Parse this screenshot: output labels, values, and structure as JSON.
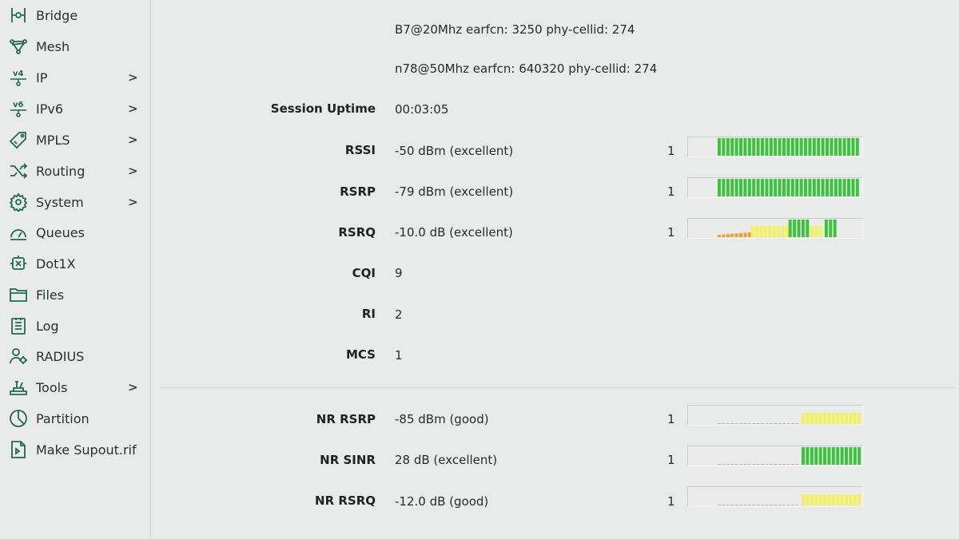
{
  "colors": {
    "accent_green": "#1f6b4f",
    "bar_green": "#3cc23c",
    "bar_yellow": "#f2f25a",
    "bar_orange": "#f0a030",
    "bar_gray": "#b9b9b9"
  },
  "sidebar": {
    "items": [
      {
        "label": "Bridge",
        "icon": "bridge-icon",
        "has_submenu": false
      },
      {
        "label": "Mesh",
        "icon": "mesh-icon",
        "has_submenu": false
      },
      {
        "label": "IP",
        "icon": "ipv4-icon",
        "has_submenu": true
      },
      {
        "label": "IPv6",
        "icon": "ipv6-icon",
        "has_submenu": true
      },
      {
        "label": "MPLS",
        "icon": "tag-icon",
        "has_submenu": true
      },
      {
        "label": "Routing",
        "icon": "routing-icon",
        "has_submenu": true
      },
      {
        "label": "System",
        "icon": "gear-icon",
        "has_submenu": true
      },
      {
        "label": "Queues",
        "icon": "gauge-icon",
        "has_submenu": false
      },
      {
        "label": "Dot1X",
        "icon": "dot1x-icon",
        "has_submenu": false
      },
      {
        "label": "Files",
        "icon": "folder-icon",
        "has_submenu": false
      },
      {
        "label": "Log",
        "icon": "log-icon",
        "has_submenu": false
      },
      {
        "label": "RADIUS",
        "icon": "users-icon",
        "has_submenu": false
      },
      {
        "label": "Tools",
        "icon": "tools-icon",
        "has_submenu": true
      },
      {
        "label": "Partition",
        "icon": "pie-icon",
        "has_submenu": false
      },
      {
        "label": "Make Supout.rif",
        "icon": "supout-icon",
        "has_submenu": false
      }
    ],
    "chevron": ">"
  },
  "main": {
    "band_lines": [
      "B7@20Mhz earfcn: 3250 phy-cellid: 274",
      "n78@50Mhz earfcn: 640320 phy-cellid: 274"
    ],
    "rows": [
      {
        "label": "Session Uptime",
        "value": "00:03:05"
      },
      {
        "label": "RSSI",
        "value": "-50 dBm (excellent)",
        "count": "1",
        "bar": {
          "gray": 0,
          "orange": 0,
          "yellow": 0,
          "green": 1.0
        }
      },
      {
        "label": "RSRP",
        "value": "-79 dBm (excellent)",
        "count": "1",
        "bar": {
          "gray": 0,
          "orange": 0,
          "yellow": 0,
          "green": 1.0
        }
      },
      {
        "label": "RSRQ",
        "value": "-10.0 dB (excellent)",
        "count": "1",
        "bar": {
          "gray": 0,
          "orange": 0.23,
          "yellow": 0.26,
          "green": 0.15,
          "yellow2": 0.1,
          "green2": 0.1
        }
      },
      {
        "label": "CQI",
        "value": "9"
      },
      {
        "label": "RI",
        "value": "2"
      },
      {
        "label": "MCS",
        "value": "1"
      }
    ],
    "nr_rows": [
      {
        "label": "NR RSRP",
        "value": "-85 dBm (good)",
        "count": "1",
        "bar": {
          "gray": 0.58,
          "yellow": 0.42,
          "green": 0
        }
      },
      {
        "label": "NR SINR",
        "value": "28 dB (excellent)",
        "count": "1",
        "bar": {
          "gray": 0.58,
          "yellow": 0,
          "green": 0.42
        }
      },
      {
        "label": "NR RSRQ",
        "value": "-12.0 dB (good)",
        "count": "1",
        "bar": {
          "gray": 0.58,
          "yellow": 0.42,
          "green": 0
        }
      }
    ]
  }
}
